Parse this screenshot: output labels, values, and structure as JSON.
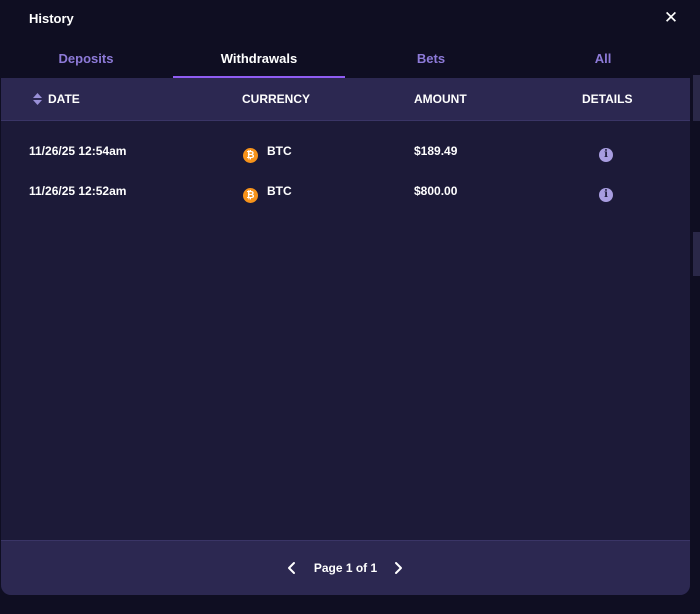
{
  "header": {
    "title": "History",
    "close_glyph": "✕"
  },
  "tabs": [
    {
      "label": "Deposits",
      "active": false
    },
    {
      "label": "Withdrawals",
      "active": true
    },
    {
      "label": "Bets",
      "active": false
    },
    {
      "label": "All",
      "active": false
    }
  ],
  "table": {
    "columns": {
      "date": "DATE",
      "currency": "CURRENCY",
      "amount": "AMOUNT",
      "details": "DETAILS"
    },
    "rows": [
      {
        "date": "11/26/25 12:54am",
        "currency": "BTC",
        "currency_icon": "bitcoin-icon",
        "amount": "$189.49",
        "details_icon": "info-icon"
      },
      {
        "date": "11/26/25 12:52am",
        "currency": "BTC",
        "currency_icon": "bitcoin-icon",
        "amount": "$800.00",
        "details_icon": "info-icon"
      }
    ]
  },
  "pagination": {
    "label": "Page 1 of 1",
    "prev_icon": "chevron-left-icon",
    "next_icon": "chevron-right-icon"
  },
  "colors": {
    "background": "#0f0e22",
    "panel": "#1c1a38",
    "table_header": "#2c2851",
    "accent": "#8f5cf2",
    "tab_inactive": "#8d7ad8",
    "btc": "#f7931a"
  }
}
